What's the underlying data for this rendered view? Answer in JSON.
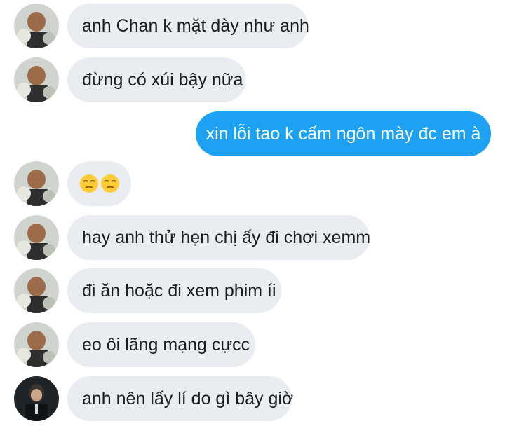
{
  "messages": [
    {
      "side": "in",
      "avatar": "user-a",
      "text": "anh Chan k mặt dày như anh"
    },
    {
      "side": "in",
      "avatar": "user-a",
      "text": "đừng có xúi bậy nữa"
    },
    {
      "side": "out",
      "text": "xin lỗi tao k cấm ngôn mày đc em à"
    },
    {
      "side": "in",
      "avatar": "user-a",
      "emoji": [
        "unamused-face-icon",
        "unamused-face-icon"
      ]
    },
    {
      "side": "in",
      "avatar": "user-a",
      "text": "hay anh thử hẹn chị ấy đi chơi xemm"
    },
    {
      "side": "in",
      "avatar": "user-a",
      "text": "đi ăn hoặc đi xem phim íi"
    },
    {
      "side": "in",
      "avatar": "user-a",
      "text": "eo ôi lãng mạng cựcc"
    },
    {
      "side": "in",
      "avatar": "user-b",
      "text": "anh nên lấy lí do gì bây giờ"
    }
  ],
  "colors": {
    "incoming_bubble": "#e9edf1",
    "outgoing_bubble": "#1da1f2",
    "text": "#1c1c1c"
  }
}
